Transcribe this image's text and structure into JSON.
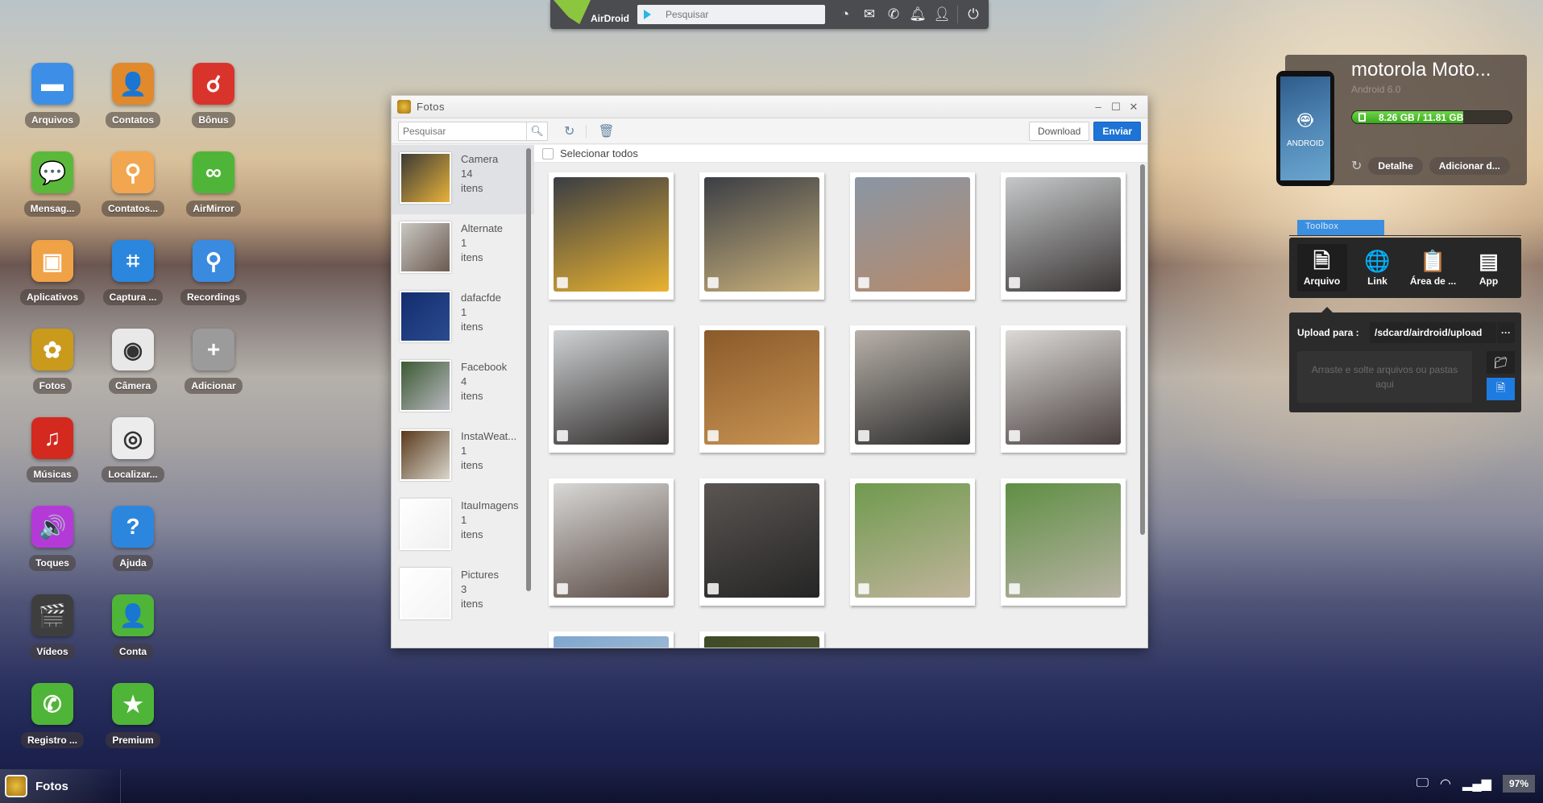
{
  "topbar": {
    "brand": "AirDroid",
    "search_placeholder": "Pesquisar",
    "icons": [
      "speedometer-icon",
      "compose-message-icon",
      "phone-icon",
      "bell-icon",
      "user-icon",
      "power-icon"
    ]
  },
  "desktop": {
    "apps": [
      {
        "label": "Arquivos",
        "icon": "folder-icon",
        "color": "#3d8ee6",
        "glyph": "▬"
      },
      {
        "label": "Contatos",
        "icon": "contacts-book-icon",
        "color": "#e0892d",
        "glyph": "👤"
      },
      {
        "label": "Bônus",
        "icon": "bonus-icon",
        "color": "#d9342b",
        "glyph": "☌"
      },
      {
        "label": "Mensag...",
        "icon": "message-bubble-icon",
        "color": "#5ab93a",
        "glyph": "💬"
      },
      {
        "label": "Contatos...",
        "icon": "contacts-folder-icon",
        "color": "#f2a650",
        "glyph": "⚲"
      },
      {
        "label": "AirMirror",
        "icon": "binoculars-icon",
        "color": "#4fb538",
        "glyph": "∞"
      },
      {
        "label": "Aplicativos",
        "icon": "package-icon",
        "color": "#f0a246",
        "glyph": "▣"
      },
      {
        "label": "Captura ...",
        "icon": "crop-icon",
        "color": "#2b86dd",
        "glyph": "⌗"
      },
      {
        "label": "Recordings",
        "icon": "recordings-folder-icon",
        "color": "#3a8ae0",
        "glyph": "⚲"
      },
      {
        "label": "Fotos",
        "icon": "photos-icon",
        "color": "#c99a1c",
        "glyph": "✿"
      },
      {
        "label": "Câmera",
        "icon": "camera-icon",
        "color": "#e8e8e8",
        "glyph": "◉"
      },
      {
        "label": "Adicionar",
        "icon": "add-icon",
        "color": "#9b9b9b",
        "glyph": "+"
      },
      {
        "label": "Músicas",
        "icon": "music-note-icon",
        "color": "#d3291f",
        "glyph": "♫"
      },
      {
        "label": "Localizar...",
        "icon": "radar-icon",
        "color": "#ececec",
        "glyph": "◎"
      },
      {
        "label": "Toques",
        "icon": "speaker-icon",
        "color": "#b43ad8",
        "glyph": "🔊"
      },
      {
        "label": "Ajuda",
        "icon": "help-icon",
        "color": "#2c86de",
        "glyph": "?"
      },
      {
        "label": "Vídeos",
        "icon": "clapperboard-icon",
        "color": "#3e3e3e",
        "glyph": "🎬"
      },
      {
        "label": "Conta",
        "icon": "account-icon",
        "color": "#4fb538",
        "glyph": "👤"
      },
      {
        "label": "Registro ...",
        "icon": "call-log-icon",
        "color": "#4fb538",
        "glyph": "✆"
      },
      {
        "label": "Premium",
        "icon": "star-icon",
        "color": "#4fb538",
        "glyph": "★"
      }
    ]
  },
  "window": {
    "title": "Fotos",
    "search_placeholder": "Pesquisar",
    "download_label": "Download",
    "send_label": "Enviar",
    "select_all_label": "Selecionar todos",
    "albums": [
      {
        "name": "Camera",
        "count": "14",
        "unit": "itens",
        "selected": true,
        "colors": [
          "#3b3a36",
          "#e8b23a"
        ]
      },
      {
        "name": "Alternate",
        "count": "1",
        "unit": "itens",
        "selected": false,
        "colors": [
          "#c9c7c2",
          "#6b5a50"
        ]
      },
      {
        "name": "dafacfde",
        "count": "1",
        "unit": "itens",
        "selected": false,
        "colors": [
          "#132d6e",
          "#2a4b8f"
        ]
      },
      {
        "name": "Facebook",
        "count": "4",
        "unit": "itens",
        "selected": false,
        "colors": [
          "#3c5a32",
          "#b8b8c0"
        ]
      },
      {
        "name": "InstaWeat...",
        "count": "1",
        "unit": "itens",
        "selected": false,
        "colors": [
          "#5a3a1c",
          "#d9d6cc"
        ]
      },
      {
        "name": "ItauImagens",
        "count": "1",
        "unit": "itens",
        "selected": false,
        "colors": [
          "#ffffff",
          "#f0f0f0"
        ]
      },
      {
        "name": "Pictures",
        "count": "3",
        "unit": "itens",
        "selected": false,
        "colors": [
          "#ffffff",
          "#f4f4f4"
        ]
      }
    ],
    "photos": [
      {
        "desc": "pan with eggs and tomato",
        "colors": [
          "#3a3d44",
          "#e9b230"
        ]
      },
      {
        "desc": "pan with chopped tomato",
        "colors": [
          "#3b3e45",
          "#c8b07a"
        ]
      },
      {
        "desc": "selfie thumbs up with city view",
        "colors": [
          "#8a96a4",
          "#b58a6c"
        ]
      },
      {
        "desc": "selfie on balcony",
        "colors": [
          "#c5c8c9",
          "#3a3535"
        ]
      },
      {
        "desc": "selfie with buildings",
        "colors": [
          "#cfd2d4",
          "#2f2b2a"
        ]
      },
      {
        "desc": "wooden door with kangaroo sign",
        "colors": [
          "#8a5a2a",
          "#c99453"
        ]
      },
      {
        "desc": "projector screen in room",
        "colors": [
          "#b8b1a9",
          "#2b2b2b"
        ]
      },
      {
        "desc": "group selfie",
        "colors": [
          "#dcdad6",
          "#4a4040"
        ]
      },
      {
        "desc": "classroom audience",
        "colors": [
          "#d8d8d6",
          "#5a4a44"
        ]
      },
      {
        "desc": "people with police officers",
        "colors": [
          "#5a5552",
          "#252525"
        ]
      },
      {
        "desc": "boy in park",
        "colors": [
          "#6f9a4e",
          "#c1b49c"
        ]
      },
      {
        "desc": "park with trees",
        "colors": [
          "#5f8f44",
          "#b8b2a4"
        ]
      },
      {
        "desc": "partial photo",
        "colors": [
          "#7ea6cf",
          "#d0d6dc"
        ]
      },
      {
        "desc": "partial photo",
        "colors": [
          "#3e4a26",
          "#6d6a3a"
        ]
      }
    ]
  },
  "device": {
    "name": "motorola Moto...",
    "os": "Android 6.0",
    "phone_label": "ANDROID",
    "storage_text": "8.26 GB / 11.81 GB",
    "storage_used_fraction": 0.699,
    "detail_label": "Detalhe",
    "add_label": "Adicionar d..."
  },
  "toolbox": {
    "tab_label": "Toolbox",
    "items": [
      {
        "label": "Arquivo",
        "icon": "file-icon",
        "glyph": "🗎",
        "selected": true
      },
      {
        "label": "Link",
        "icon": "globe-link-icon",
        "glyph": "🌐",
        "selected": false
      },
      {
        "label": "Área de ...",
        "icon": "clipboard-icon",
        "glyph": "📋",
        "selected": false
      },
      {
        "label": "App",
        "icon": "app-box-icon",
        "glyph": "▤",
        "selected": false
      }
    ],
    "upload_label": "Upload para :",
    "upload_path": "/sdcard/airdroid/upload",
    "more_label": "···",
    "drop_text": "Arraste e solte arquivos ou pastas aqui",
    "accent": "#1e7be0"
  },
  "taskbar": {
    "active_app": "Fotos",
    "battery": "97%"
  }
}
